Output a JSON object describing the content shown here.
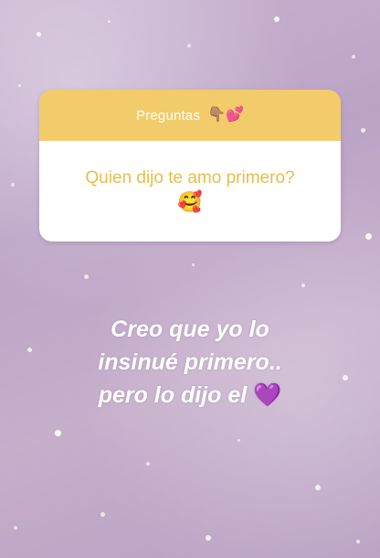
{
  "background": {
    "description_color": "#c3aacb",
    "sparkle_color": "#ffffff"
  },
  "question_card": {
    "header_label": "Preguntas",
    "header_emoji": "👇🏽💕",
    "question": "Quien dijo te amo primero?",
    "question_emoji": "🥰",
    "header_color": "#f2cb6b",
    "question_color": "#e7bd4a"
  },
  "answer": {
    "line1": "Creo que yo lo",
    "line2": "insinué primero..",
    "line3": "pero lo dijo el",
    "line3_emoji": "💜"
  }
}
